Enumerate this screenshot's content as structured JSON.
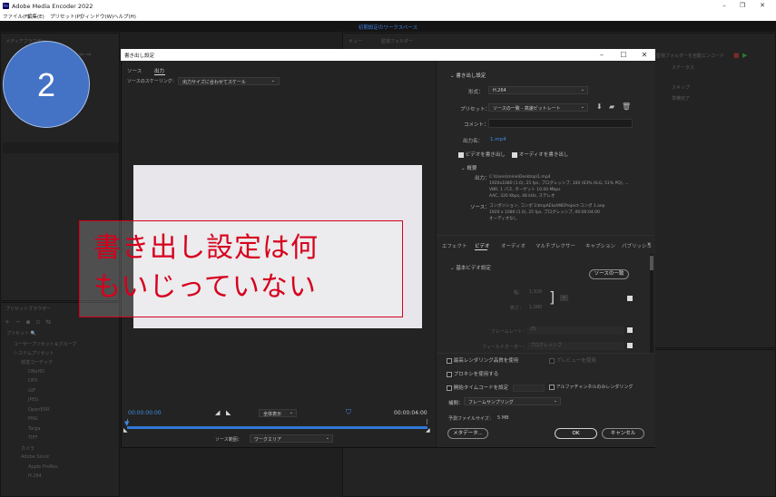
{
  "app": {
    "title": "Adobe Media Encoder 2022",
    "icon_text": "Me"
  },
  "menu": [
    "ファイル(F)",
    "編集(E)",
    "プリセット(P)",
    "ウィンドウ(W)",
    "ヘルプ(H)"
  ],
  "workspace_label": "初期設定のワークスペース",
  "left_panel": {
    "media_browser": "メディアブラウザー",
    "preset_browser": "プリセットブラウザー",
    "user_presets": "ユーザープリセット＆グループ",
    "system_presets": "システムプリセット",
    "tree": [
      "放送コーデック",
      "DNxHD",
      "DPX",
      "GIF",
      "JPEG",
      "OpenEXR",
      "PNG",
      "Targa",
      "TIFF",
      "カメラ",
      "Adobe Stock",
      "Apple ProRes",
      "H.264"
    ]
  },
  "queue_tabs": [
    "キュー",
    "監視フォルダー"
  ],
  "right_status": {
    "auto_encode": "監視フォルダーを自動エンコード",
    "status_header": "ステータス",
    "rows": [
      "スキップ",
      "準備完了"
    ]
  },
  "badge": "2",
  "dialog": {
    "title": "書き出し設定",
    "tabs": [
      "ソース",
      "出力"
    ],
    "scaling_label": "ソースのスケーリング：",
    "scaling_value": "出力サイズに合わせてスケール",
    "annotation": [
      "書き出し設定は何",
      "もいじっていない"
    ],
    "timecode_start": "00:00:00:00",
    "timecode_end": "00:00:04:00",
    "zoom_value": "全体表示",
    "range_label": "ソース範囲：",
    "range_value": "ワークエリア",
    "export_settings": {
      "header": "書き出し設定",
      "format_label": "形式：",
      "format_value": "H.264",
      "preset_label": "プリセット：",
      "preset_value": "ソースの一致 - 高速ビットレート",
      "comment_label": "コメント：",
      "output_name_label": "出力名：",
      "output_name_value": "1.mp4",
      "export_video": "ビデオを書き出し",
      "export_audio": "オーディオを書き出し"
    },
    "summary": {
      "header": "概要",
      "output_label": "出力：",
      "output_lines": [
        "C:\\Users\\mine\\Desktop\\1.mp4",
        "1920x1080 (1.0), 25 fps, プログレッシブ, 100 (63% HLG, 51% PQ), ...",
        "VBR, 1 パス, ターゲット 10.00 Mbps",
        "AAC, 320 Kbps, 48 kHz, ステレオ"
      ],
      "source_label": "ソース：",
      "source_lines": [
        "コンポジション, コンポ 1\\tmpAEtoAMEProject-コンポ 1.aep",
        "1920 x 1080 (1.0), 25 fps, プログレッシブ, 00:00:04:00",
        "オーディオなし"
      ]
    },
    "lower_tabs": [
      "エフェクト",
      "ビデオ",
      "オーディオ",
      "マルチプレクサー",
      "キャプション",
      "パブリッシュ"
    ],
    "basic_video": {
      "header": "基本ビデオ設定",
      "match_source_button": "ソースの一致",
      "width_label": "幅：",
      "width_value": "1,920",
      "height_label": "高さ：",
      "height_value": "1,080",
      "frame_rate_label": "フレームレート：",
      "frame_rate_value": "25",
      "field_order_label": "フィールドオーダー：",
      "field_order_value": "プログレッシブ"
    },
    "options": {
      "max_render": "最高レンダリング品質を使用",
      "use_preview": "プレビューを使用",
      "use_proxy": "プロキシを使用する",
      "set_timecode": "開始タイムコードを設定",
      "alpha_only": "アルファチャンネルのみレンダリング",
      "interp_label": "補間：",
      "interp_value": "フレームサンプリング",
      "est_size_label": "予測ファイルサイズ：",
      "est_size_value": "5 MB"
    },
    "buttons": {
      "metadata": "メタデータ...",
      "ok": "OK",
      "cancel": "キャンセル"
    }
  }
}
